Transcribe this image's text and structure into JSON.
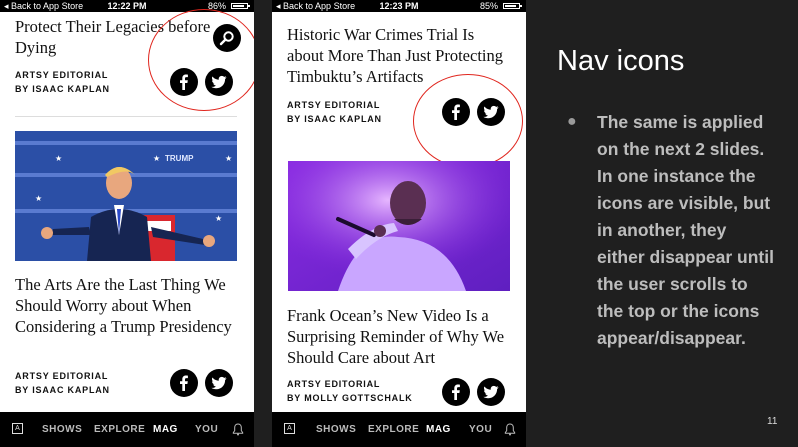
{
  "phone_left": {
    "status": {
      "back": "Back to App Store",
      "time": "12:22 PM",
      "battery": "86%",
      "battery_level": 0.86
    },
    "articles": [
      {
        "title": "Protect Their Legacies before Dying",
        "section": "ARTSY EDITORIAL",
        "byline": "BY ISAAC KAPLAN"
      },
      {
        "title": "The Arts Are the Last Thing We Should Worry about When Considering a Trump Presidency",
        "section": "ARTSY EDITORIAL",
        "byline": "BY ISAAC KAPLAN"
      }
    ],
    "image_sign_text": "TRUMP"
  },
  "phone_right": {
    "status": {
      "back": "Back to App Store",
      "time": "12:23 PM",
      "battery": "85%",
      "battery_level": 0.85
    },
    "articles": [
      {
        "title": "Historic War Crimes Trial Is about More Than Just Protecting Timbuktu’s Artifacts",
        "section": "ARTSY EDITORIAL",
        "byline": "BY ISAAC KAPLAN"
      },
      {
        "title": "Frank Ocean’s New Video Is a Surprising Reminder of Why We Should Care about Art",
        "section": "ARTSY EDITORIAL",
        "byline": "BY MOLLY GOTTSCHALK"
      }
    ]
  },
  "nav": {
    "logo": "A",
    "items": [
      "SHOWS",
      "EXPLORE",
      "MAG",
      "YOU"
    ],
    "active": "MAG"
  },
  "icons": [
    "search-icon",
    "facebook-icon",
    "twitter-icon",
    "bell-icon",
    "artsy-logo-icon"
  ],
  "colors": {
    "annotation_circle": "#e0261e",
    "slide_background": "#1f1f1f",
    "slide_title": "#ffffff",
    "slide_text": "#bdbdbd"
  },
  "slide": {
    "title": "Nav icons",
    "bullet": "The same is applied on the next 2 slides. In one instance the icons are visible, but in another, they either disappear until the user scrolls to the top or the icons appear/disappear.",
    "page_number": "11"
  }
}
